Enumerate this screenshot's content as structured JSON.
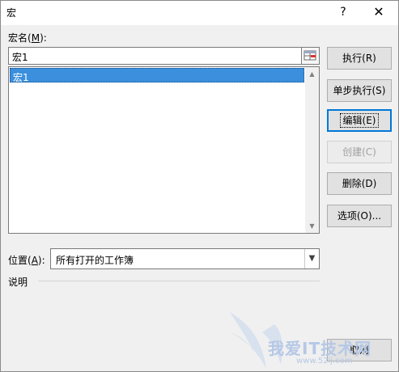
{
  "window": {
    "title": "宏",
    "help_label": "?",
    "close_label": "✕"
  },
  "macro_name": {
    "label": "宏名",
    "mnemonic": "M",
    "value": "宏1"
  },
  "macro_list": {
    "items": [
      "宏1"
    ],
    "selected_index": 0
  },
  "location": {
    "label": "位置",
    "mnemonic": "A",
    "value": "所有打开的工作簿"
  },
  "description": {
    "label": "说明"
  },
  "buttons": {
    "run": "执行(R)",
    "step_into": "单步执行(S)",
    "edit": "编辑(E)",
    "create": "创建(C)",
    "delete": "删除(D)",
    "options": "选项(O)...",
    "cancel": "取消"
  },
  "watermark": {
    "text": "我爱IT技术网",
    "url": "www.52ij.com"
  },
  "colors": {
    "selection": "#3b8fdd",
    "focus_border": "#0078d7"
  }
}
